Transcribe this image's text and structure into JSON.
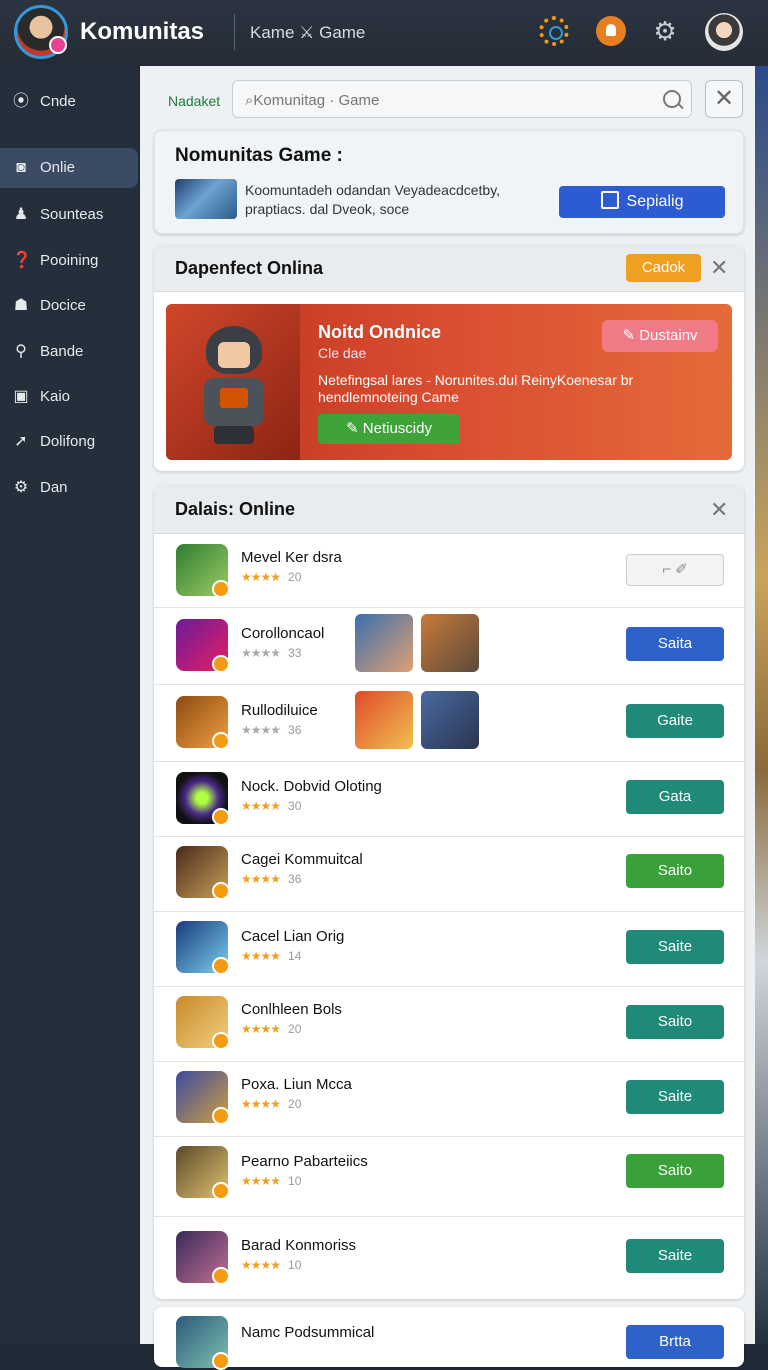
{
  "header": {
    "app_title": "Komunitas",
    "subtitle": "Kame ⚔ Game",
    "icons": [
      "spinner-gear-icon",
      "notification-bell-icon",
      "settings-gear-icon",
      "user-avatar"
    ]
  },
  "sidebar": {
    "items": [
      {
        "label": "Cnde",
        "icon": "map-pin-icon"
      },
      {
        "label": "Onlie",
        "icon": "gamepad-icon",
        "active": true
      },
      {
        "label": "Sounteas",
        "icon": "people-icon"
      },
      {
        "label": "Pooining",
        "icon": "help-icon"
      },
      {
        "label": "Docice",
        "icon": "user-icon"
      },
      {
        "label": "Bande",
        "icon": "search-icon"
      },
      {
        "label": "Kaio",
        "icon": "monitor-icon"
      },
      {
        "label": "Dolifong",
        "icon": "share-icon"
      },
      {
        "label": "Dan",
        "icon": "gear-icon"
      }
    ]
  },
  "search": {
    "tag": "Nadaket",
    "placeholder": "⌕Komunitag · Game",
    "close": "✕"
  },
  "intro": {
    "title": "Nomunitas Game :",
    "description": "Koomuntadeh odandan Veyadeacdcetby, praptiacs. dal Dveok, soce",
    "button": "Sepialig"
  },
  "featured": {
    "title": "Dapenfect Onlina",
    "badge": "Cadok",
    "close": "✕",
    "banner_title": "Noitd Ondnice",
    "banner_sub": "Cle dae",
    "banner_desc": "Netefingsal lares - Norunites.dul ReinyKoenesar br hendlemnoteing Came",
    "banner_button": "Netiuscidy",
    "banner_pill": "Dustainv"
  },
  "online": {
    "title": "Dalais:  Online",
    "close": "✕",
    "rows": [
      {
        "name": "Mevel Ker dsra",
        "stars": "★★★★",
        "count": "20",
        "button": "⌐ ✐",
        "btn_color": "ghost"
      },
      {
        "name": "Corolloncaol",
        "stars": "★★★★",
        "count": "33",
        "button": "Saita",
        "btn_color": "#2f62c9"
      },
      {
        "name": "Rullodiluice",
        "stars": "★★★★",
        "count": "36",
        "button": "Gaite",
        "btn_color": "#1f8a78"
      },
      {
        "name": "Nock. Dobvid Oloting",
        "stars": "★★★★",
        "count": "30",
        "button": "Gata",
        "btn_color": "#1f8a78"
      },
      {
        "name": "Cagei Kommuitcal",
        "stars": "★★★★",
        "count": "36",
        "button": "Saito",
        "btn_color": "#3aa13a"
      },
      {
        "name": "Cacel Lian Orig",
        "stars": "★★★★",
        "count": "14",
        "button": "Saite",
        "btn_color": "#1f8a78"
      },
      {
        "name": "Conlhleen Bols",
        "stars": "★★★★",
        "count": "20",
        "button": "Saito",
        "btn_color": "#1f8a78"
      },
      {
        "name": "Poxa. Liun Mcca",
        "stars": "★★★★",
        "count": "20",
        "button": "Saite",
        "btn_color": "#1f8a78"
      },
      {
        "name": "Pearno Pabarteiics",
        "stars": "★★★★",
        "count": "10",
        "button": "Saito",
        "btn_color": "#3aa13a"
      },
      {
        "name": "Barad Konmoriss",
        "stars": "★★★★",
        "count": "10",
        "button": "Saite",
        "btn_color": "#1f8a78"
      }
    ],
    "last_row": {
      "name": "Namc Podsummical",
      "button": "Brtta"
    }
  }
}
